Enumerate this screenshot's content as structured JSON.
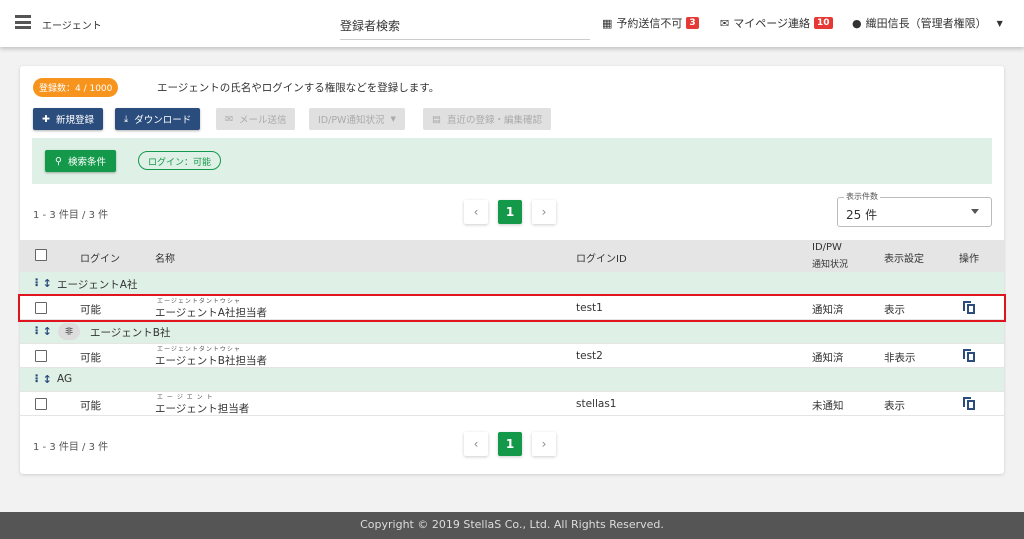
{
  "header": {
    "app_title": "エージェント",
    "search_value": "登録者検索",
    "reserve_label": "予約送信不可",
    "reserve_count": "3",
    "mypage_label": "マイページ連絡",
    "mypage_count": "10",
    "user": "織田信長（管理者権限）"
  },
  "info": {
    "count": "登録数：4 / 1000",
    "description": "エージェントの氏名やログインする権限などを登録します。"
  },
  "toolbar": {
    "new": "新規登録",
    "download": "ダウンロード",
    "mail": "メール送信",
    "idpw": "ID/PW通知状況",
    "recent": "直近の登録・編集確認"
  },
  "filter": {
    "button": "検索条件",
    "chip": "ログイン：可能"
  },
  "pagination": {
    "range": "1 - 3 件目 / 3 件",
    "prev": "‹",
    "page": "1",
    "next": "›"
  },
  "per_page": {
    "label": "表示件数",
    "value": "25 件"
  },
  "table": {
    "headers": {
      "login": "ログイン",
      "name": "名称",
      "login_id": "ログインID",
      "idpw1": "ID/PW",
      "idpw2": "通知状況",
      "display": "表示設定",
      "action": "操作"
    },
    "groups": [
      {
        "name": "エージェントA社",
        "tag": "",
        "rows": [
          {
            "login": "可能",
            "ruby": "エージェントタントウシャ",
            "name": "エージェントA社担当者",
            "login_id": "test1",
            "notify": "通知済",
            "display": "表示"
          }
        ]
      },
      {
        "name": "エージェントB社",
        "tag": "非",
        "rows": [
          {
            "login": "可能",
            "ruby": "エージェントタントウシャ",
            "name": "エージェントB社担当者",
            "login_id": "test2",
            "notify": "通知済",
            "display": "非表示"
          }
        ]
      },
      {
        "name": "AG",
        "tag": "",
        "rows": [
          {
            "login": "可能",
            "ruby": "エ ー ジ エ ン ト",
            "name": "エージェント担当者",
            "login_id": "stellas1",
            "notify": "未通知",
            "display": "表示"
          }
        ]
      }
    ]
  },
  "footer": {
    "text": "Copyright © 2019 StellaS Co., Ltd. All Rights Reserved."
  }
}
